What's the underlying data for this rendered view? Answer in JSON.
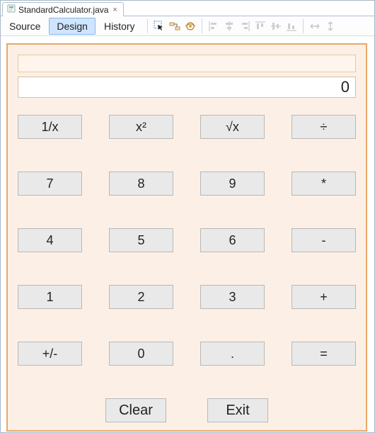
{
  "tab": {
    "filename": "StandardCalculator.java"
  },
  "subtabs": {
    "source": "Source",
    "design": "Design",
    "history": "History"
  },
  "toolbar_icons": [
    "selection-mode-icon",
    "connection-mode-icon",
    "preview-icon",
    "align-left-icon",
    "align-center-h-icon",
    "align-right-icon",
    "align-top-icon",
    "align-center-v-icon",
    "align-bottom-icon",
    "resize-h-icon",
    "resize-v-icon"
  ],
  "display": {
    "history": "",
    "value": "0"
  },
  "buttons": {
    "row0": [
      "1/x",
      "x²",
      "√x",
      "÷"
    ],
    "row1": [
      "7",
      "8",
      "9",
      "*"
    ],
    "row2": [
      "4",
      "5",
      "6",
      "-"
    ],
    "row3": [
      "1",
      "2",
      "3",
      "+"
    ],
    "row4": [
      "+/-",
      "0",
      ".",
      "="
    ]
  },
  "bottom": {
    "clear": "Clear",
    "exit": "Exit"
  }
}
